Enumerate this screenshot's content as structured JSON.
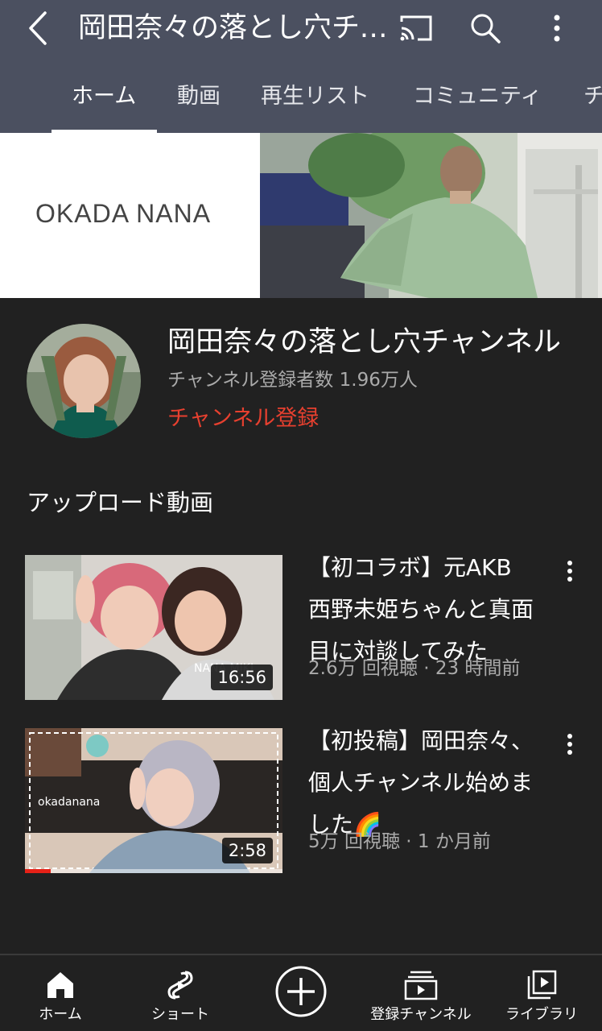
{
  "header": {
    "title": "岡田奈々の落とし穴チャンネル",
    "back_icon": "back-arrow-icon",
    "cast_icon": "cast-icon",
    "search_icon": "search-icon",
    "more_icon": "more-vert-icon"
  },
  "tabs": [
    {
      "label": "ホーム",
      "active": true
    },
    {
      "label": "動画",
      "active": false
    },
    {
      "label": "再生リスト",
      "active": false
    },
    {
      "label": "コミュニティ",
      "active": false
    },
    {
      "label": "チ",
      "active": false
    }
  ],
  "banner": {
    "text": "OKADA NANA"
  },
  "channel": {
    "name": "岡田奈々の落とし穴チャンネル",
    "subscribers": "チャンネル登録者数 1.96万人",
    "subscribe_label": "チャンネル登録",
    "subscribe_color": "#e7402f"
  },
  "section": {
    "title": "アップロード動画"
  },
  "videos": [
    {
      "title": "【初コラボ】元AKB西野未姫ちゃんと真面目に対談してみた",
      "meta": "2.6万 回視聴 · 23 時間前",
      "duration": "16:56",
      "thumb_text": "NANA MIKI",
      "watched_progress": 0
    },
    {
      "title": "【初投稿】岡田奈々、個人チャンネル始めました🌈",
      "meta": "5万 回視聴 · 1 か月前",
      "duration": "2:58",
      "thumb_text": "okadanana",
      "watched_progress": 0.1
    }
  ],
  "bottom_nav": [
    {
      "label": "ホーム",
      "icon": "home-icon"
    },
    {
      "label": "ショート",
      "icon": "shorts-icon"
    },
    {
      "label": "",
      "icon": "create-plus-icon"
    },
    {
      "label": "登録チャンネル",
      "icon": "subscriptions-icon"
    },
    {
      "label": "ライブラリ",
      "icon": "library-icon"
    }
  ],
  "colors": {
    "header_bg": "#4b5060",
    "body_bg": "#212121",
    "accent": "#e7402f"
  }
}
